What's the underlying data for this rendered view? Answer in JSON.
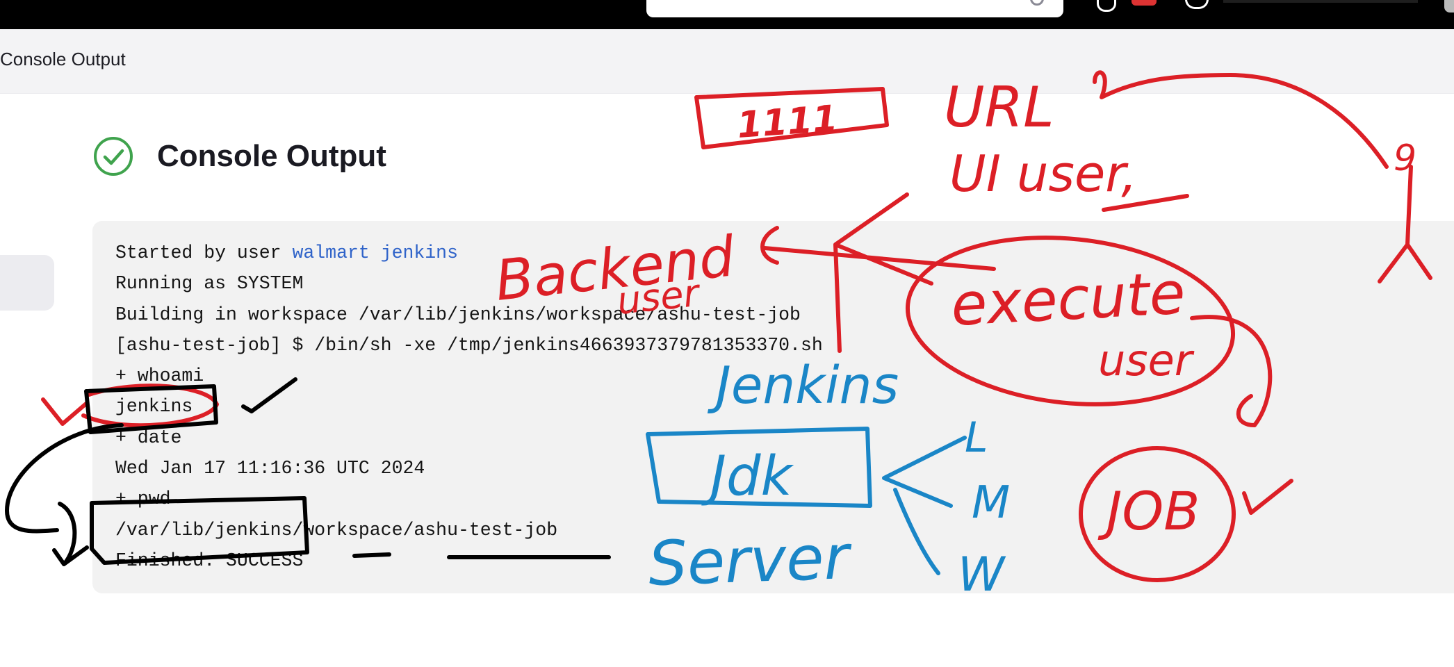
{
  "breadcrumb": {
    "current": "Console Output"
  },
  "page": {
    "title": "Console Output",
    "status_icon": "check-circle-icon",
    "status_color": "#3fa34d"
  },
  "console": {
    "line0_prefix": "Started by user ",
    "line0_user": "walmart jenkins",
    "lines": [
      "Running as SYSTEM",
      "Building in workspace /var/lib/jenkins/workspace/ashu-test-job",
      "[ashu-test-job] $ /bin/sh -xe /tmp/jenkins4663937379781353370.sh",
      "+ whoami",
      "jenkins",
      "+ date",
      "Wed Jan 17 11:16:36 UTC 2024",
      "+ pwd",
      "/var/lib/jenkins/workspace/ashu-test-job",
      "Finished: SUCCESS"
    ]
  },
  "annotations": {
    "red_color": "#dc1f26",
    "blue_color": "#1a86c7",
    "black_color": "#000000",
    "labels": {
      "ui_box": "1111",
      "url": "URL",
      "ui_user": "UI user,",
      "number": "9",
      "backend": "Backend",
      "backend_sub": "user",
      "execute": "execute",
      "execute_sub": "user",
      "jenkins": "Jenkins",
      "jdk": "Jdk",
      "server": "Server",
      "os_l": "L",
      "os_m": "M",
      "os_w": "W",
      "job": "JOB"
    }
  }
}
